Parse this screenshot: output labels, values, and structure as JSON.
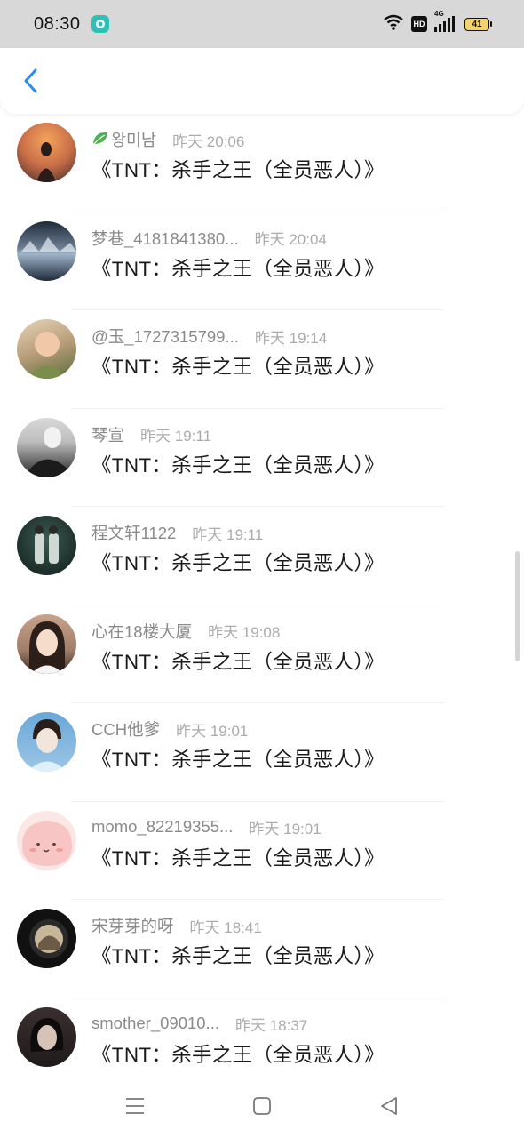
{
  "status_bar": {
    "time": "08:30",
    "icons": [
      "notification-app-icon",
      "wifi-icon",
      "hd-icon",
      "4g-signal-icon",
      "battery-icon"
    ],
    "hd_label": "HD",
    "network_label": "4G",
    "battery_level": "41"
  },
  "nav": {
    "back_icon": "chevron-left-icon",
    "accent": "#2a8cf0"
  },
  "messages": [
    {
      "name": "왕미남",
      "name_prefix_icon": "leaf-icon",
      "time": "昨天 20:06",
      "text": "《TNT：杀手之王（全员恶人）》",
      "avatar_colors": [
        "#f4a45c",
        "#3b2a2a"
      ]
    },
    {
      "name": "梦巷_4181841380...",
      "time": "昨天 20:04",
      "text": "《TNT：杀手之王（全员恶人）》",
      "avatar_colors": [
        "#1e2a3a",
        "#9fb4c8"
      ]
    },
    {
      "name": "@玉_1727315799...",
      "time": "昨天 19:14",
      "text": "《TNT：杀手之王（全员恶人）》",
      "avatar_colors": [
        "#e8d5b8",
        "#5a6b3a"
      ]
    },
    {
      "name": "琴宣",
      "time": "昨天 19:11",
      "text": "《TNT：杀手之王（全员恶人）》",
      "avatar_colors": [
        "#d9d9d9",
        "#222222"
      ]
    },
    {
      "name": "程文轩1122",
      "time": "昨天 19:11",
      "text": "《TNT：杀手之王（全员恶人）》",
      "avatar_colors": [
        "#1d2f2a",
        "#cfd8d2"
      ]
    },
    {
      "name": "心在18楼大厦",
      "time": "昨天 19:08",
      "text": "《TNT：杀手之王（全员恶人）》",
      "avatar_colors": [
        "#c9a38a",
        "#3a2a22"
      ]
    },
    {
      "name": "CCH他爹",
      "time": "昨天 19:01",
      "text": "《TNT：杀手之王（全员恶人）》",
      "avatar_colors": [
        "#6aa8d8",
        "#f2e6dc"
      ]
    },
    {
      "name": "momo_82219355...",
      "time": "昨天 19:01",
      "text": "《TNT：杀手之王（全员恶人）》",
      "avatar_colors": [
        "#f7c6c4",
        "#fbe8e6"
      ]
    },
    {
      "name": "宋芽芽的呀",
      "time": "昨天 18:41",
      "text": "《TNT：杀手之王（全员恶人）》",
      "avatar_colors": [
        "#111111",
        "#c7b79a"
      ]
    },
    {
      "name": "smother_09010...",
      "name_inline_icon": "pumpkin-seeds-emoji",
      "time": "昨天 18:37",
      "text": "《TNT：杀手之王（全员恶人）》",
      "avatar_colors": [
        "#201a1a",
        "#d7c2b8"
      ]
    }
  ],
  "system_nav": {
    "icons": [
      "menu-icon",
      "home-square-icon",
      "back-triangle-icon"
    ]
  }
}
